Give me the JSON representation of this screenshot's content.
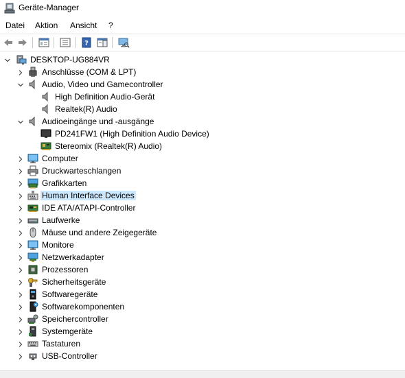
{
  "window": {
    "title": "Geräte-Manager"
  },
  "menu": [
    {
      "label": "Datei"
    },
    {
      "label": "Aktion"
    },
    {
      "label": "Ansicht"
    },
    {
      "label": "?"
    }
  ],
  "toolbar": [
    {
      "name": "back-icon"
    },
    {
      "name": "forward-icon"
    },
    {
      "name": "properties-icon"
    },
    {
      "name": "show-hide-console-tree-icon"
    },
    {
      "name": "help-icon"
    },
    {
      "name": "action-pane-icon"
    },
    {
      "name": "scan-hardware-icon"
    }
  ],
  "tree": {
    "root": {
      "label": "DESKTOP-UG884VR",
      "icon": "computer-icon",
      "expanded": true
    },
    "items": [
      {
        "label": "Anschlüsse (COM & LPT)",
        "icon": "port-icon",
        "level": 1,
        "expanded": false
      },
      {
        "label": "Audio, Video und Gamecontroller",
        "icon": "speaker-icon",
        "level": 1,
        "expanded": true
      },
      {
        "label": "High Definition Audio-Gerät",
        "icon": "speaker-icon",
        "level": 2
      },
      {
        "label": "Realtek(R) Audio",
        "icon": "speaker-icon",
        "level": 2
      },
      {
        "label": "Audioeingänge und -ausgänge",
        "icon": "speaker-icon",
        "level": 1,
        "expanded": true
      },
      {
        "label": "PD241FW1 (High Definition Audio Device)",
        "icon": "monitor-dark-icon",
        "level": 2
      },
      {
        "label": "Stereomix (Realtek(R) Audio)",
        "icon": "audio-card-icon",
        "level": 2
      },
      {
        "label": "Computer",
        "icon": "monitor-icon",
        "level": 1,
        "expanded": false
      },
      {
        "label": "Druckwarteschlangen",
        "icon": "printer-icon",
        "level": 1,
        "expanded": false
      },
      {
        "label": "Grafikkarten",
        "icon": "display-adapter-icon",
        "level": 1,
        "expanded": false
      },
      {
        "label": "Human Interface Devices",
        "icon": "hid-icon",
        "level": 1,
        "expanded": false,
        "selected": true
      },
      {
        "label": "IDE ATA/ATAPI-Controller",
        "icon": "ide-icon",
        "level": 1,
        "expanded": false
      },
      {
        "label": "Laufwerke",
        "icon": "drive-icon",
        "level": 1,
        "expanded": false
      },
      {
        "label": "Mäuse und andere Zeigegeräte",
        "icon": "mouse-icon",
        "level": 1,
        "expanded": false
      },
      {
        "label": "Monitore",
        "icon": "monitor-icon",
        "level": 1,
        "expanded": false
      },
      {
        "label": "Netzwerkadapter",
        "icon": "network-icon",
        "level": 1,
        "expanded": false
      },
      {
        "label": "Prozessoren",
        "icon": "processor-icon",
        "level": 1,
        "expanded": false
      },
      {
        "label": "Sicherheitsgeräte",
        "icon": "security-key-icon",
        "level": 1,
        "expanded": false
      },
      {
        "label": "Softwaregeräte",
        "icon": "software-device-icon",
        "level": 1,
        "expanded": false
      },
      {
        "label": "Softwarekomponenten",
        "icon": "software-component-icon",
        "level": 1,
        "expanded": false
      },
      {
        "label": "Speichercontroller",
        "icon": "storage-controller-icon",
        "level": 1,
        "expanded": false
      },
      {
        "label": "Systemgeräte",
        "icon": "system-device-icon",
        "level": 1,
        "expanded": false
      },
      {
        "label": "Tastaturen",
        "icon": "keyboard-icon",
        "level": 1,
        "expanded": false
      },
      {
        "label": "USB-Controller",
        "icon": "usb-icon",
        "level": 1,
        "expanded": false
      }
    ]
  },
  "colors": {
    "selection": "#cce8ff",
    "accent": "#0078d7"
  }
}
